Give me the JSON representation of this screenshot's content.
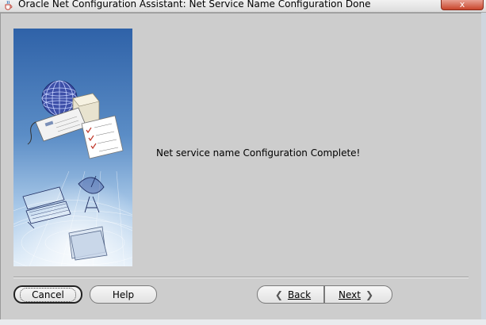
{
  "window": {
    "title": "Oracle Net Configuration Assistant: Net Service Name Configuration Done",
    "close_label": "x"
  },
  "main": {
    "message": "Net service name Configuration Complete!"
  },
  "buttons": {
    "cancel": "Cancel",
    "help": "Help",
    "back": "Back",
    "next": "Next"
  },
  "icons": {
    "app": "java-cup-icon",
    "back": "chevron-left-icon",
    "next": "chevron-right-icon"
  },
  "colors": {
    "dialog_bg": "#cdcdcd",
    "image_top": "#2f62a8",
    "image_bottom": "#d7e8f6"
  }
}
